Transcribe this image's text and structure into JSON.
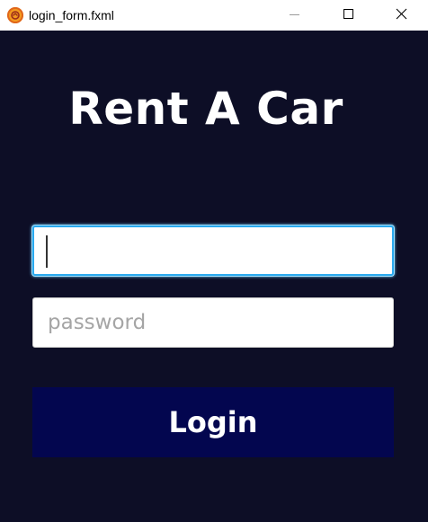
{
  "window": {
    "title": "login_form.fxml",
    "icon": "app-logo-icon",
    "controls": {
      "minimize": "minimize-icon",
      "maximize": "maximize-icon",
      "close": "close-icon"
    }
  },
  "form": {
    "heading": "Rent A Car",
    "username": {
      "value": "",
      "placeholder": ""
    },
    "password": {
      "value": "",
      "placeholder": "password"
    },
    "login_label": "Login"
  },
  "colors": {
    "background": "#0d0e26",
    "button": "#03064f",
    "focus_ring": "#2aa9ee",
    "app_icon": "#f39a1f"
  }
}
